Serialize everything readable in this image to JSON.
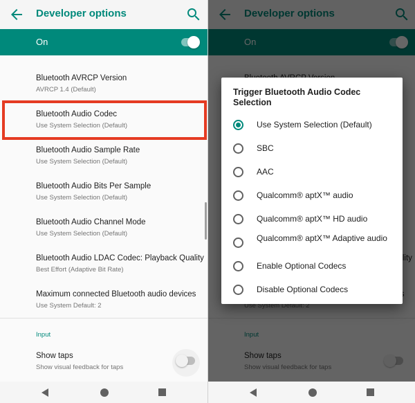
{
  "app_bar": {
    "title": "Developer options",
    "back_icon": "arrow-back-icon",
    "search_icon": "search-icon"
  },
  "master_switch": {
    "label": "On",
    "state": "on"
  },
  "settings": [
    {
      "title": "Bluetooth AVRCP Version",
      "summary": "AVRCP 1.4 (Default)"
    },
    {
      "title": "Bluetooth Audio Codec",
      "summary": "Use System Selection (Default)"
    },
    {
      "title": "Bluetooth Audio Sample Rate",
      "summary": "Use System Selection (Default)"
    },
    {
      "title": "Bluetooth Audio Bits Per Sample",
      "summary": "Use System Selection (Default)"
    },
    {
      "title": "Bluetooth Audio Channel Mode",
      "summary": "Use System Selection (Default)"
    },
    {
      "title": "Bluetooth Audio LDAC Codec: Playback Quality",
      "summary": "Best Effort (Adaptive Bit Rate)"
    },
    {
      "title": "Maximum connected Bluetooth audio devices",
      "summary": "Use System Default: 2"
    }
  ],
  "section_input": "Input",
  "show_taps": {
    "title": "Show taps",
    "summary": "Show visual feedback for taps",
    "state": "off"
  },
  "dialog": {
    "title": "Trigger Bluetooth Audio Codec Selection",
    "selected_index": 0,
    "options": [
      "Use System Selection (Default)",
      "SBC",
      "AAC",
      "Qualcomm® aptX™ audio",
      "Qualcomm® aptX™ HD audio",
      "Qualcomm® aptX™ Adaptive audio",
      "Enable Optional Codecs",
      "Disable Optional Codecs"
    ]
  },
  "nav_bar": {
    "icons": [
      "nav-back-icon",
      "nav-home-icon",
      "nav-recents-icon"
    ]
  },
  "colors": {
    "accent": "#00897b",
    "highlight_border": "#e53b22",
    "scrim": "#000000"
  }
}
